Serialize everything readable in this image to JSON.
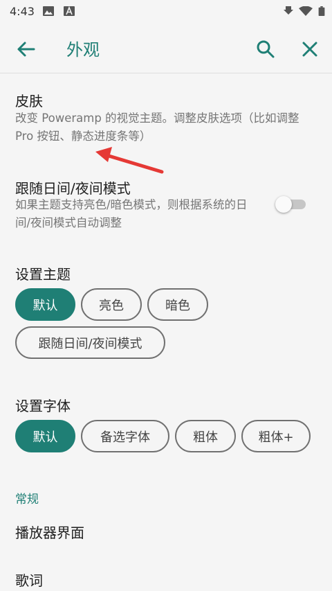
{
  "status_bar": {
    "time": "4:43"
  },
  "app_bar": {
    "title": "外观"
  },
  "skin": {
    "title": "皮肤",
    "desc": "改变 Poweramp 的视觉主题。调整皮肤选项（比如调整 Pro 按钮、静态进度条等）"
  },
  "follow_day_night": {
    "title": "跟随日间/夜间模式",
    "desc": "如果主题支持亮色/暗色模式，则根据系统的日间/夜间模式自动调整",
    "enabled": false
  },
  "theme": {
    "label": "设置主题",
    "chips": [
      "默认",
      "亮色",
      "暗色",
      "跟随日间/夜间模式"
    ],
    "selected": "默认"
  },
  "font": {
    "label": "设置字体",
    "chips": [
      "默认",
      "备选字体",
      "粗体",
      "粗体+"
    ],
    "selected": "默认"
  },
  "general": {
    "category": "常规",
    "items": [
      "播放器界面",
      "歌词"
    ]
  },
  "colors": {
    "accent": "#1f7f75",
    "annotation_arrow": "#e53935"
  }
}
